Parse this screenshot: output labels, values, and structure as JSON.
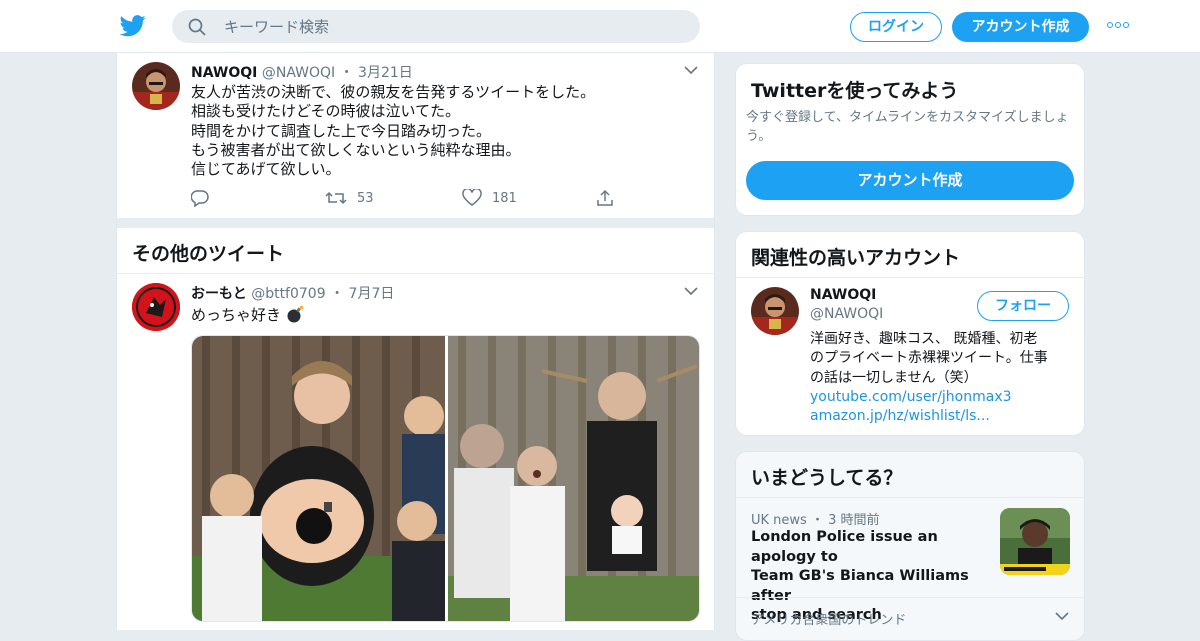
{
  "header": {
    "search_placeholder": "キーワード検索",
    "login_label": "ログイン",
    "signup_label": "アカウント作成"
  },
  "tweet": {
    "name": "NAWOQI",
    "handle": "@NAWOQI",
    "sep": "・",
    "date": "3月21日",
    "lines": [
      "友人が苦渋の決断で、彼の親友を告発するツイートをした。",
      "相談も受けたけどその時彼は泣いてた。",
      "時間をかけて調査した上で今日踏み切った。",
      "もう被害者が出て欲しくないという純粋な理由。",
      "信じてあげて欲しい。"
    ],
    "retweets": "53",
    "likes": "181"
  },
  "others": {
    "title": "その他のツイート",
    "tweet": {
      "name": "おーもと",
      "handle": "@bttf0709",
      "sep": "・",
      "date": "7月7日",
      "text": "めっちゃ好き"
    }
  },
  "signup_card": {
    "title": "Twitterを使ってみよう",
    "subtitle": "今すぐ登録して、タイムラインをカスタマイズしましょう。",
    "button": "アカウント作成"
  },
  "related": {
    "title": "関連性の高いアカウント",
    "name": "NAWOQI",
    "handle": "@NAWOQI",
    "follow": "フォロー",
    "bio_lines": [
      "洋画好き、趣味コス、 既婚種、初老",
      "のプライベート赤裸裸ツイート。仕事",
      "の話は一切しません（笑）"
    ],
    "link1": "youtube.com/user/jhonmax3",
    "link2": "amazon.jp/hz/wishlist/ls..."
  },
  "trends": {
    "title": "いまどうしてる？",
    "news_source": "UK news",
    "news_sep": "・",
    "news_time": "3 時間前",
    "news_lines": [
      "London Police issue an apology to",
      "Team GB's Bianca Williams after",
      "stop and search"
    ],
    "trends_label": "アメリカ合衆国のトレンド"
  },
  "colors": {
    "accent": "#1da1f2",
    "background": "#e6ecf0",
    "text": "#14171a",
    "muted": "#657786"
  }
}
